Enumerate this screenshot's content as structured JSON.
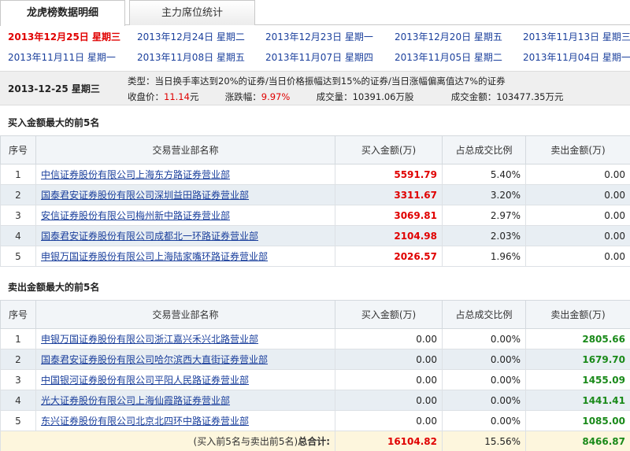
{
  "tabs": [
    "龙虎榜数据明细",
    "主力席位统计"
  ],
  "dates_row1": [
    "2013年12月25日 星期三",
    "2013年12月24日 星期二",
    "2013年12月23日 星期一",
    "2013年12月20日 星期五",
    "2013年11月13日 星期三"
  ],
  "dates_row2": [
    "2013年11月11日 星期一",
    "2013年11月08日 星期五",
    "2013年11月07日 星期四",
    "2013年11月05日 星期二",
    "2013年11月04日 星期一"
  ],
  "info": {
    "date": "2013-12-25 星期三",
    "type_label": "类型：",
    "type_text": "当日换手率达到20%的证券/当日价格振幅达到15%的证券/当日涨幅偏离值达7%的证券",
    "close_label": "收盘价：",
    "close_value": "11.14",
    "close_unit": "元",
    "change_label": "涨跌幅：",
    "change_value": "9.97%",
    "volume_label": "成交量：",
    "volume_value": "10391.06万股",
    "amount_label": "成交金额：",
    "amount_value": "103477.35万元"
  },
  "headers": [
    "序号",
    "交易营业部名称",
    "买入金额(万)",
    "占总成交比例",
    "卖出金额(万)"
  ],
  "buy_section": {
    "title": "买入金额最大的前5名",
    "rows": [
      {
        "idx": "1",
        "name": "中信证券股份有限公司上海东方路证券营业部",
        "buy": "5591.79",
        "ratio": "5.40%",
        "sell": "0.00"
      },
      {
        "idx": "2",
        "name": "国泰君安证券股份有限公司深圳益田路证券营业部",
        "buy": "3311.67",
        "ratio": "3.20%",
        "sell": "0.00"
      },
      {
        "idx": "3",
        "name": "安信证券股份有限公司梅州新中路证券营业部",
        "buy": "3069.81",
        "ratio": "2.97%",
        "sell": "0.00"
      },
      {
        "idx": "4",
        "name": "国泰君安证券股份有限公司成都北一环路证券营业部",
        "buy": "2104.98",
        "ratio": "2.03%",
        "sell": "0.00"
      },
      {
        "idx": "5",
        "name": "申银万国证券股份有限公司上海陆家嘴环路证券营业部",
        "buy": "2026.57",
        "ratio": "1.96%",
        "sell": "0.00"
      }
    ]
  },
  "sell_section": {
    "title": "卖出金额最大的前5名",
    "rows": [
      {
        "idx": "1",
        "name": "申银万国证券股份有限公司浙江嘉兴禾兴北路营业部",
        "buy": "0.00",
        "ratio": "0.00%",
        "sell": "2805.66"
      },
      {
        "idx": "2",
        "name": "国泰君安证券股份有限公司哈尔滨西大直街证券营业部",
        "buy": "0.00",
        "ratio": "0.00%",
        "sell": "1679.70"
      },
      {
        "idx": "3",
        "name": "中国银河证券股份有限公司平阳人民路证券营业部",
        "buy": "0.00",
        "ratio": "0.00%",
        "sell": "1455.09"
      },
      {
        "idx": "4",
        "name": "光大证券股份有限公司上海仙霞路证券营业部",
        "buy": "0.00",
        "ratio": "0.00%",
        "sell": "1441.41"
      },
      {
        "idx": "5",
        "name": "东兴证券股份有限公司北京北四环中路证券营业部",
        "buy": "0.00",
        "ratio": "0.00%",
        "sell": "1085.00"
      }
    ]
  },
  "total": {
    "note": "(买入前5名与卖出前5名)",
    "label": "总合计:",
    "buy": "16104.82",
    "ratio": "15.56%",
    "sell": "8466.87"
  }
}
